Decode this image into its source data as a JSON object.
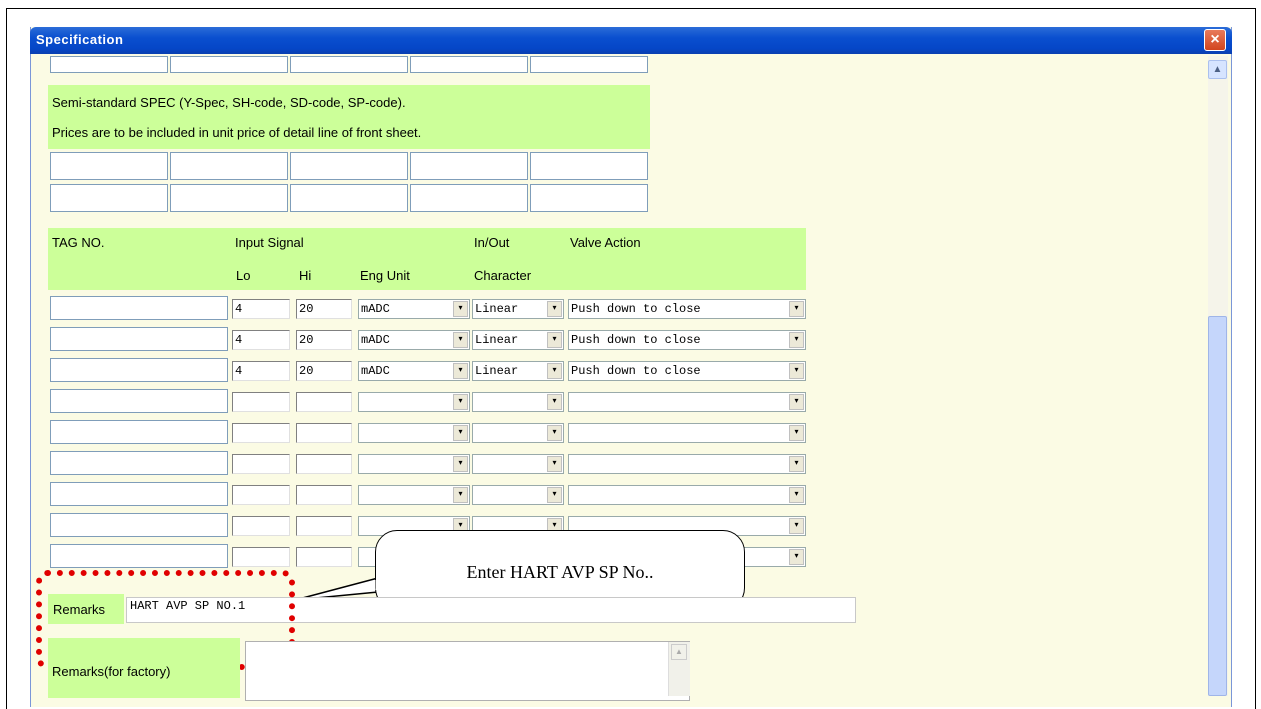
{
  "window": {
    "title": "Specification",
    "close_symbol": "×"
  },
  "semi_standard": {
    "line1": "Semi-standard SPEC (Y-Spec, SH-code, SD-code, SP-code).",
    "line2": "Prices are to be included in unit price of detail line of front sheet."
  },
  "table": {
    "headers": {
      "tag_no": "TAG NO.",
      "input_signal": "Input Signal",
      "in_out": "In/Out",
      "valve_action": "Valve Action",
      "lo": "Lo",
      "hi": "Hi",
      "eng_unit": "Eng Unit",
      "character": "Character"
    },
    "rows": [
      {
        "tag": "",
        "lo": "4",
        "hi": "20",
        "eng_unit": "mADC",
        "character": "Linear",
        "valve_action": "Push down to close"
      },
      {
        "tag": "",
        "lo": "4",
        "hi": "20",
        "eng_unit": "mADC",
        "character": "Linear",
        "valve_action": "Push down to close"
      },
      {
        "tag": "",
        "lo": "4",
        "hi": "20",
        "eng_unit": "mADC",
        "character": "Linear",
        "valve_action": "Push down to close"
      },
      {
        "tag": "",
        "lo": "",
        "hi": "",
        "eng_unit": "",
        "character": "",
        "valve_action": ""
      },
      {
        "tag": "",
        "lo": "",
        "hi": "",
        "eng_unit": "",
        "character": "",
        "valve_action": ""
      },
      {
        "tag": "",
        "lo": "",
        "hi": "",
        "eng_unit": "",
        "character": "",
        "valve_action": ""
      },
      {
        "tag": "",
        "lo": "",
        "hi": "",
        "eng_unit": "",
        "character": "",
        "valve_action": ""
      },
      {
        "tag": "",
        "lo": "",
        "hi": "",
        "eng_unit": "",
        "character": "",
        "valve_action": ""
      },
      {
        "tag": "",
        "lo": "",
        "hi": "",
        "eng_unit": "",
        "character": "",
        "valve_action": ""
      }
    ]
  },
  "remarks": {
    "label": "Remarks",
    "value": "HART AVP SP NO.1"
  },
  "remarks_factory": {
    "label": "Remarks(for factory)",
    "value": ""
  },
  "callout": {
    "text": "Enter HART AVP SP No.."
  },
  "icons": {
    "dropdown": "▾",
    "scroll_up": "▲"
  },
  "colors": {
    "title_bar": "#0a4fcf",
    "section_green": "#ccff99",
    "window_bg": "#fbfbe4",
    "highlight": "#e00000"
  }
}
